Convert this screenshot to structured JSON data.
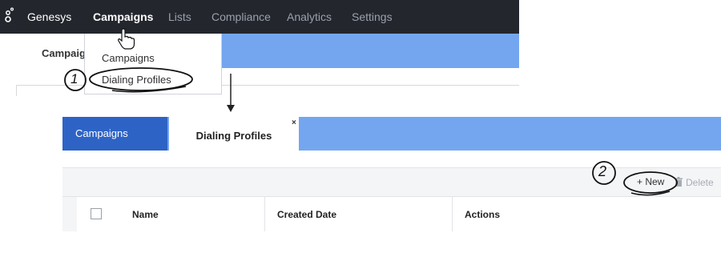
{
  "app": {
    "brand": "Genesys",
    "logo_icon": "genesys-logo-icon"
  },
  "nav": {
    "items": [
      {
        "label": "Campaigns",
        "active": true
      },
      {
        "label": "Lists"
      },
      {
        "label": "Compliance"
      },
      {
        "label": "Analytics"
      },
      {
        "label": "Settings"
      }
    ]
  },
  "background_page": {
    "title_cut": "Campaig"
  },
  "dropdown": {
    "items": [
      {
        "label": "Campaigns"
      },
      {
        "label": "Dialing Profiles"
      }
    ]
  },
  "annotations": {
    "step1": "1",
    "step2": "2"
  },
  "panel": {
    "tabs": [
      {
        "label": "Campaigns"
      },
      {
        "label": "Dialing Profiles",
        "close": "×"
      }
    ],
    "toolbar": {
      "new_label": "+ New",
      "delete_label": "Delete"
    },
    "table": {
      "columns": [
        "Name",
        "Created Date",
        "Actions"
      ]
    }
  },
  "colors": {
    "nav_bg": "#23262d",
    "accent_blue": "#2e63c6",
    "light_blue": "#74a6f0"
  }
}
